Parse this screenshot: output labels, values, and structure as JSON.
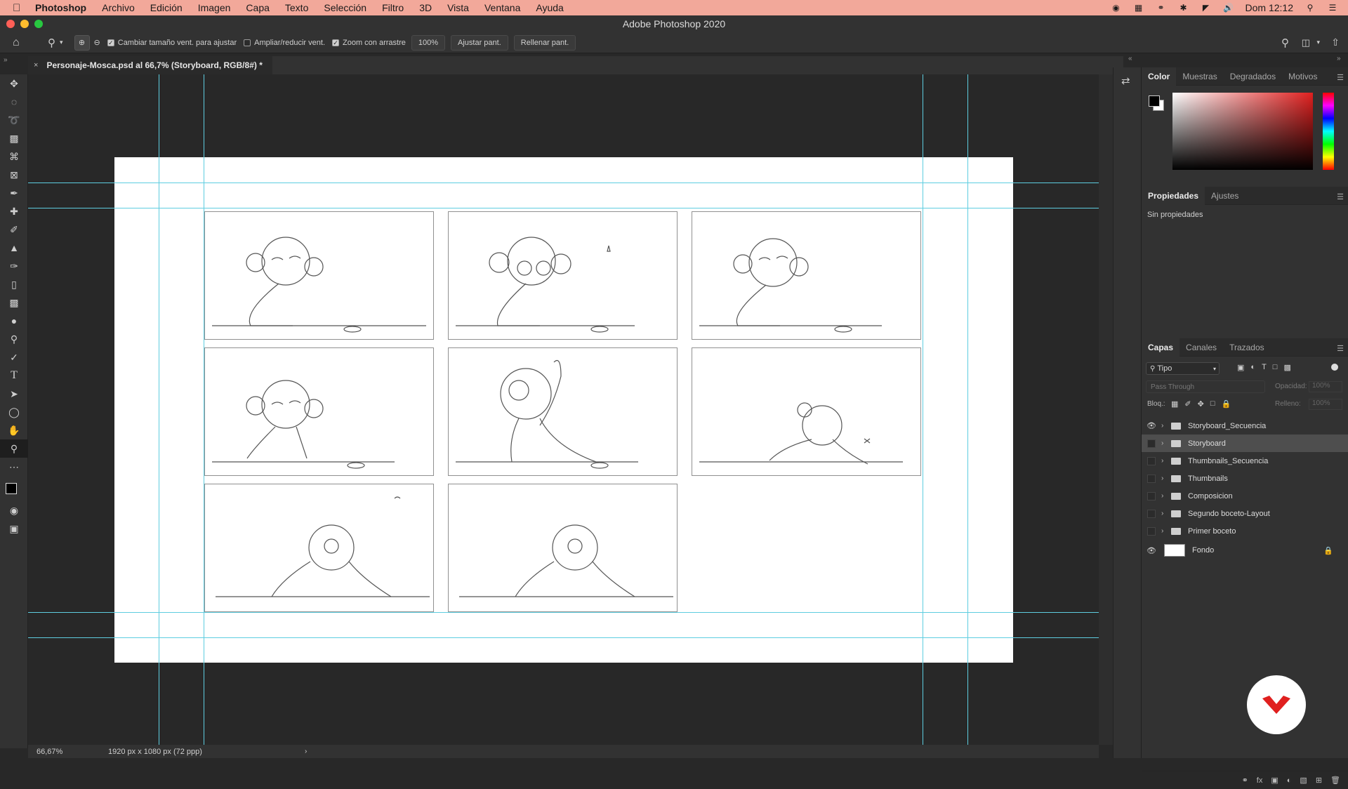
{
  "menubar": {
    "app": "Photoshop",
    "items": [
      "Archivo",
      "Edición",
      "Imagen",
      "Capa",
      "Texto",
      "Selección",
      "Filtro",
      "3D",
      "Vista",
      "Ventana",
      "Ayuda"
    ],
    "clock": "Dom 12:12"
  },
  "window": {
    "title": "Adobe Photoshop 2020"
  },
  "options": {
    "resize_windows": "Cambiar tamaño vent. para ajustar",
    "zoom_all": "Ampliar/reducir vent.",
    "scrubby_zoom": "Zoom con arrastre",
    "zoom_value": "100%",
    "fit_screen": "Ajustar pant.",
    "fill_screen": "Rellenar pant."
  },
  "document": {
    "tab_label": "Personaje-Mosca.psd al 66,7% (Storyboard, RGB/8#) *"
  },
  "status": {
    "zoom": "66,67%",
    "doc_size": "1920 px x 1080 px (72 ppp)"
  },
  "color_panel": {
    "tabs": [
      "Color",
      "Muestras",
      "Degradados",
      "Motivos"
    ]
  },
  "properties_panel": {
    "tabs": [
      "Propiedades",
      "Ajustes"
    ],
    "empty_text": "Sin propiedades"
  },
  "layers_panel": {
    "tabs": [
      "Capas",
      "Canales",
      "Trazados"
    ],
    "filter_label": "Tipo",
    "blend_mode": "Pass Through",
    "opacity_label": "Opacidad:",
    "opacity_value": "100%",
    "lock_label": "Bloq.:",
    "fill_label": "Relleno:",
    "fill_value": "100%",
    "layers": [
      {
        "name": "Storyboard_Secuencia",
        "visible": true,
        "group": true,
        "selected": false
      },
      {
        "name": "Storyboard",
        "visible": false,
        "group": true,
        "selected": true
      },
      {
        "name": "Thumbnails_Secuencia",
        "visible": false,
        "group": true,
        "selected": false
      },
      {
        "name": "Thumbnails",
        "visible": false,
        "group": true,
        "selected": false
      },
      {
        "name": "Composicion",
        "visible": false,
        "group": true,
        "selected": false
      },
      {
        "name": "Segundo boceto-Layout",
        "visible": false,
        "group": true,
        "selected": false
      },
      {
        "name": "Primer boceto",
        "visible": false,
        "group": true,
        "selected": false
      },
      {
        "name": "Fondo",
        "visible": true,
        "group": false,
        "selected": false,
        "locked": true
      }
    ]
  },
  "colors": {
    "menubar": "#f2a89a",
    "guide": "#5ecde0",
    "ui_bg": "#323232",
    "brand_red": "#e0201f"
  }
}
